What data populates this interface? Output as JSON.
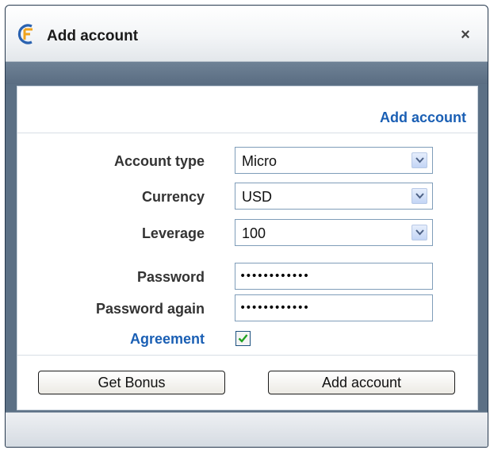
{
  "window": {
    "title": "Add account",
    "close_icon": "×"
  },
  "panel": {
    "header_link": "Add account"
  },
  "form": {
    "account_type": {
      "label": "Account type",
      "value": "Micro"
    },
    "currency": {
      "label": "Currency",
      "value": "USD"
    },
    "leverage": {
      "label": "Leverage",
      "value": "100"
    },
    "password": {
      "label": "Password",
      "value": "••••••••••••"
    },
    "password_again": {
      "label": "Password again",
      "value": "••••••••••••"
    },
    "agreement": {
      "label": "Agreement",
      "checked": true
    }
  },
  "buttons": {
    "get_bonus": "Get Bonus",
    "add_account": "Add account"
  },
  "colors": {
    "link": "#1a5fb4",
    "checkmark": "#21a121",
    "logo_primary": "#2a62b0",
    "logo_accent": "#f0a31c"
  }
}
